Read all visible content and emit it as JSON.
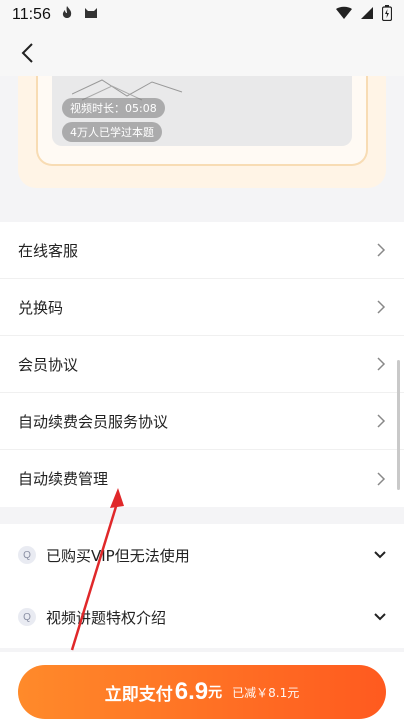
{
  "status_bar": {
    "time": "11:56",
    "icons": [
      "fire-app-icon",
      "cat-app-icon",
      "wifi-icon",
      "signal-icon",
      "battery-icon"
    ]
  },
  "nav": {
    "back_icon": "back-arrow-icon"
  },
  "video_card": {
    "duration_label": "视频时长：05:08",
    "learners_label": "4万人已学过本题"
  },
  "menu": {
    "items": [
      {
        "label": "在线客服"
      },
      {
        "label": "兑换码"
      },
      {
        "label": "会员协议"
      },
      {
        "label": "自动续费会员服务协议"
      },
      {
        "label": "自动续费管理"
      }
    ]
  },
  "faq": {
    "badge": "Q",
    "items": [
      {
        "label": "已购买VIP但无法使用"
      },
      {
        "label": "视频讲题特权介绍"
      }
    ]
  },
  "pay": {
    "label": "立即支付",
    "price": "6.9",
    "unit": "元",
    "saving": "已减￥8.1元"
  },
  "colors": {
    "accent": "#ff6a22",
    "annotation_arrow": "#e0282a"
  }
}
